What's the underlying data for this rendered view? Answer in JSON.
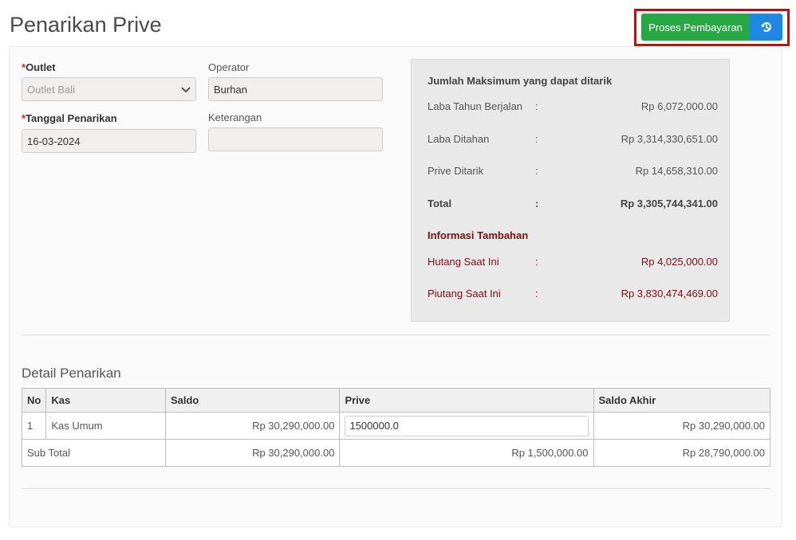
{
  "page": {
    "title": "Penarikan Prive"
  },
  "actions": {
    "proses_label": "Proses Pembayaran",
    "history_icon": "history-icon"
  },
  "form": {
    "outlet": {
      "label": "Outlet",
      "value": "Outlet Bali"
    },
    "operator": {
      "label": "Operator",
      "value": "Burhan"
    },
    "tanggal": {
      "label": "Tanggal Penarikan",
      "value": "16-03-2024"
    },
    "keterangan": {
      "label": "Keterangan",
      "value": ""
    }
  },
  "summary": {
    "title": "Jumlah Maksimum yang dapat ditarik",
    "rows": [
      {
        "label": "Laba Tahun Berjalan",
        "sep": ":",
        "value": "Rp 6,072,000.00"
      },
      {
        "label": "Laba Ditahan",
        "sep": ":",
        "value": "Rp 3,314,330,651.00"
      },
      {
        "label": "Prive Ditarik",
        "sep": ":",
        "value": "Rp 14,658,310.00"
      },
      {
        "label": "Total",
        "sep": ":",
        "value": "Rp 3,305,744,341.00"
      }
    ],
    "extra_title": "Informasi Tambahan",
    "extra_rows": [
      {
        "label": "Hutang Saat Ini",
        "sep": ":",
        "value": "Rp 4,025,000.00"
      },
      {
        "label": "Piutang Saat Ini",
        "sep": ":",
        "value": "Rp 3,830,474,469.00"
      }
    ]
  },
  "detail": {
    "title": "Detail Penarikan",
    "columns": [
      "No",
      "Kas",
      "Saldo",
      "Prive",
      "Saldo Akhir"
    ],
    "rows": [
      {
        "no": "1",
        "kas": "Kas Umum",
        "saldo": "Rp 30,290,000.00",
        "prive": "1500000.0",
        "saldo_akhir": "Rp 30,290,000.00"
      }
    ],
    "subtotal": {
      "label": "Sub Total",
      "saldo": "Rp 30,290,000.00",
      "prive": "Rp 1,500,000.00",
      "saldo_akhir": "Rp 28,790,000.00"
    }
  },
  "colors": {
    "primary_green": "#28a745",
    "primary_blue": "#1e88e5",
    "highlight_red": "#e00000",
    "required_red": "#d9232d",
    "info_maroon": "#7a1010"
  }
}
